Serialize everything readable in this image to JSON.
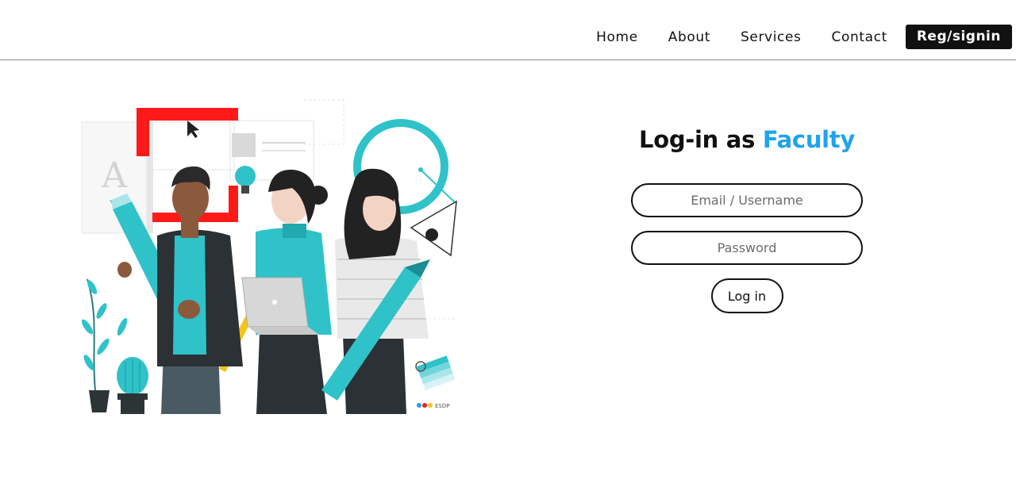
{
  "nav": {
    "links": [
      "Home",
      "About",
      "Services",
      "Contact"
    ],
    "register_signin_label": "Reg/signin"
  },
  "login": {
    "title_prefix": "Log-in as ",
    "title_highlight": "Faculty",
    "email_placeholder": "Email / Username",
    "password_placeholder": "Password",
    "submit_label": "Log in"
  },
  "illustration": {
    "letter_glyph": "A",
    "brand_badge": "ESDP"
  },
  "colors": {
    "accent": "#1fa3ec",
    "teal": "#2fc2c9",
    "dark": "#111111",
    "red": "#ff1a1a",
    "yellow": "#f5c518"
  }
}
